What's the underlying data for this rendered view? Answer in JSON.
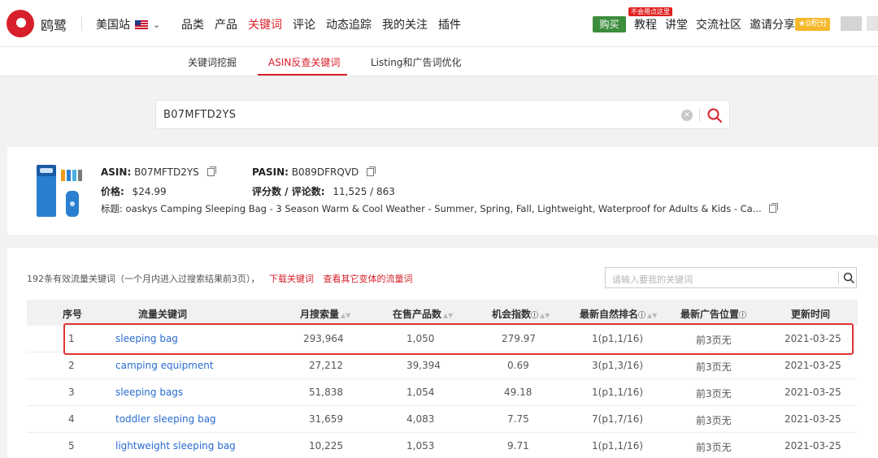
{
  "header": {
    "brand": "鸥鹭",
    "site": "美国站",
    "menu": [
      "品类",
      "产品",
      "关键词",
      "评论",
      "动态追踪",
      "我的关注",
      "插件"
    ],
    "buy_label": "购买",
    "badge": "不会用点这里",
    "links": [
      "教程",
      "讲堂",
      "交流社区",
      "邀请分享"
    ],
    "points": "0积分",
    "colors": {
      "accent": "#d7202b",
      "buy": "#3c8d3c",
      "points": "#f6b82a",
      "link": "#2a6bd1"
    }
  },
  "subnav": {
    "tabs": [
      "关键词挖掘",
      "ASIN反查关键词",
      "Listing和广告词优化"
    ]
  },
  "search": {
    "value": "B07MFTD2YS"
  },
  "product": {
    "asin_label": "ASIN:",
    "asin": "B07MFTD2YS",
    "pasin_label": "PASIN:",
    "pasin": "B089DFRQVD",
    "price_label": "价格:",
    "price": "$24.99",
    "rating_label": "评分数 / 评论数:",
    "rating": "11,525 / 863",
    "title_label": "标题:",
    "title": "oaskys Camping Sleeping Bag - 3 Season Warm & Cool Weather - Summer, Spring, Fall, Lightweight, Waterproof for Adults & Kids - Ca..."
  },
  "summary": {
    "text": "192条有效流量关键词（一个月内进入过搜索结果前3页），",
    "download": "下载关键词",
    "variants": "查看其它变体的流量词"
  },
  "keyword_search": {
    "placeholder": "请输入要我的关键词"
  },
  "table": {
    "headers": [
      "序号",
      "流量关键词",
      "月搜索量",
      "在售产品数",
      "机会指数",
      "最新自然排名",
      "最新广告位置",
      "更新时间"
    ],
    "rows": [
      [
        "1",
        "sleeping bag",
        "293,964",
        "1,050",
        "279.97",
        "1(p1,1/16)",
        "前3页无",
        "2021-03-25"
      ],
      [
        "2",
        "camping equipment",
        "27,212",
        "39,394",
        "0.69",
        "3(p1,3/16)",
        "前3页无",
        "2021-03-25"
      ],
      [
        "3",
        "sleeping bags",
        "51,838",
        "1,054",
        "49.18",
        "1(p1,1/16)",
        "前3页无",
        "2021-03-25"
      ],
      [
        "4",
        "toddler sleeping bag",
        "31,659",
        "4,083",
        "7.75",
        "7(p1,7/16)",
        "前3页无",
        "2021-03-25"
      ],
      [
        "5",
        "lightweight sleeping bag",
        "10,225",
        "1,053",
        "9.71",
        "1(p1,1/16)",
        "前3页无",
        "2021-03-25"
      ]
    ]
  }
}
